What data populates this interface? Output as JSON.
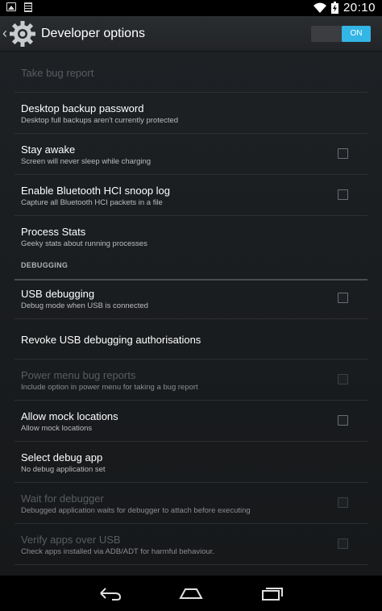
{
  "status_bar": {
    "time": "20:10",
    "icons": [
      "image-notification-icon",
      "document-notification-icon",
      "wifi-icon",
      "battery-charging-icon"
    ]
  },
  "action_bar": {
    "title": "Developer options",
    "switch_label": "ON",
    "switch_on": true,
    "accent": "#33b5e5"
  },
  "items": [
    {
      "title": "Take bug report",
      "summary": "",
      "enabled": false,
      "checkbox": false
    },
    {
      "title": "Desktop backup password",
      "summary": "Desktop full backups aren't currently protected",
      "enabled": true,
      "checkbox": false
    },
    {
      "title": "Stay awake",
      "summary": "Screen will never sleep while charging",
      "enabled": true,
      "checkbox": true,
      "checked": false
    },
    {
      "title": "Enable Bluetooth HCI snoop log",
      "summary": "Capture all Bluetooth HCI packets in a file",
      "enabled": true,
      "checkbox": true,
      "checked": false
    },
    {
      "title": "Process Stats",
      "summary": "Geeky stats about running processes",
      "enabled": true,
      "checkbox": false
    }
  ],
  "debugging": {
    "header": "DEBUGGING",
    "items": [
      {
        "title": "USB debugging",
        "summary": "Debug mode when USB is connected",
        "enabled": true,
        "checkbox": true,
        "checked": false
      },
      {
        "title": "Revoke USB debugging authorisations",
        "summary": "",
        "enabled": true,
        "checkbox": false
      },
      {
        "title": "Power menu bug reports",
        "summary": "Include option in power menu for taking a bug report",
        "enabled": false,
        "checkbox": true,
        "checked": false
      },
      {
        "title": "Allow mock locations",
        "summary": "Allow mock locations",
        "enabled": true,
        "checkbox": true,
        "checked": false
      },
      {
        "title": "Select debug app",
        "summary": "No debug application set",
        "enabled": true,
        "checkbox": false
      },
      {
        "title": "Wait for debugger",
        "summary": "Debugged application waits for debugger to attach before executing",
        "enabled": false,
        "checkbox": true,
        "checked": false
      },
      {
        "title": "Verify apps over USB",
        "summary": "Check apps installed via ADB/ADT for harmful behaviour.",
        "enabled": false,
        "checkbox": true,
        "checked": false
      }
    ]
  },
  "nav_bar": {
    "buttons": [
      "back-icon",
      "home-icon",
      "recent-apps-icon"
    ]
  }
}
